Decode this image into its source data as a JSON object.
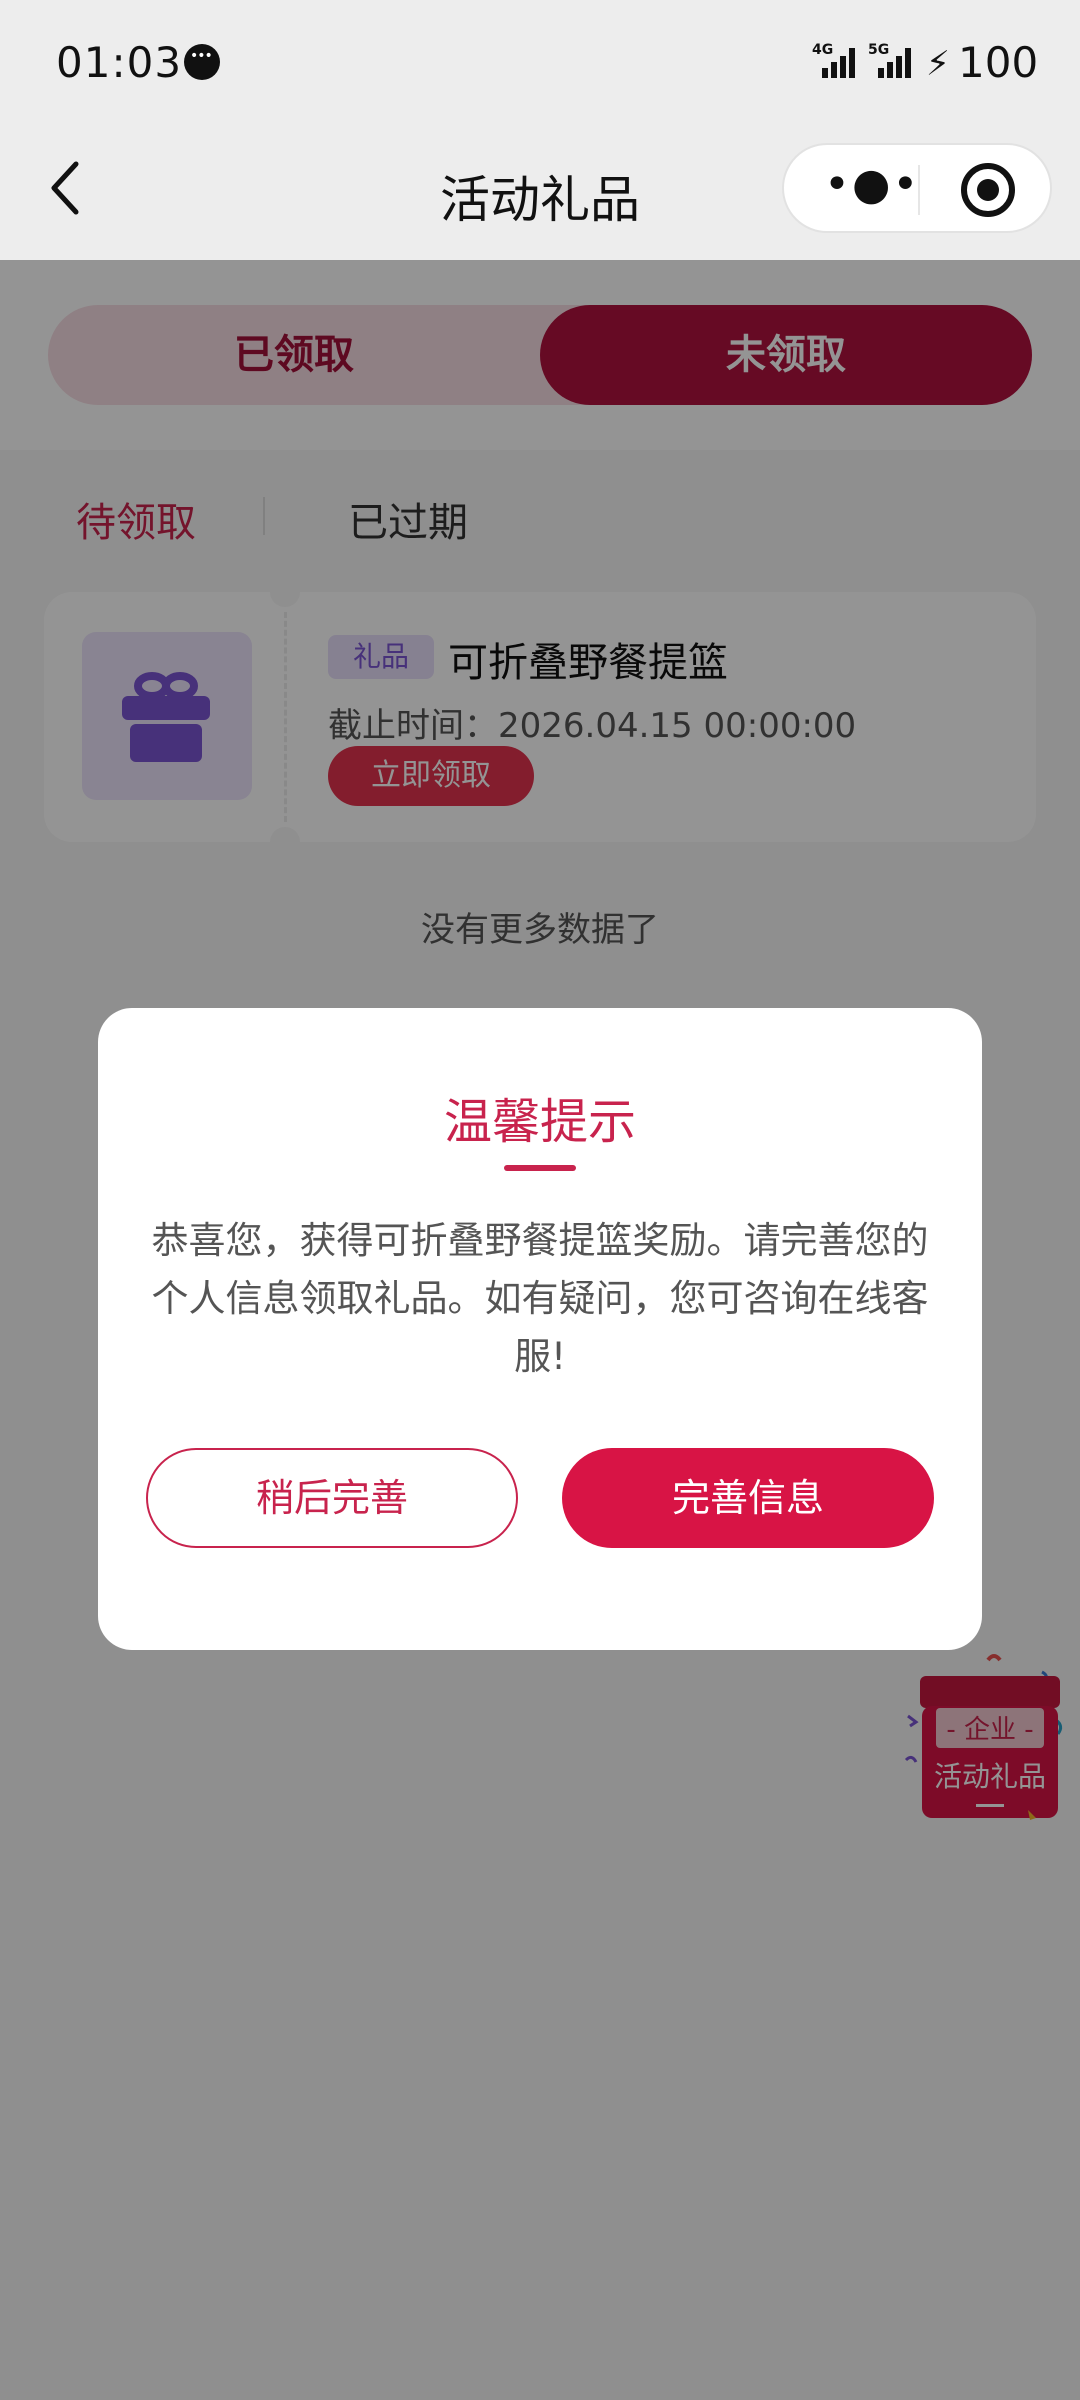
{
  "status_bar": {
    "time": "01:03",
    "network_1": "4G",
    "network_2": "5G",
    "battery": "100"
  },
  "header": {
    "title": "活动礼品"
  },
  "segment": {
    "claimed": "已领取",
    "unclaimed": "未领取",
    "active": "unclaimed"
  },
  "sub_tabs": {
    "pending": "待领取",
    "expired": "已过期",
    "active": "pending"
  },
  "gift_card": {
    "tag": "礼品",
    "name": "可折叠野餐提篮",
    "deadline": "截止时间：2026.04.15 00:00:00",
    "claim_button": "立即领取"
  },
  "list_footer": "没有更多数据了",
  "floating_badge": {
    "line1": "- 企业 -",
    "line2": "活动礼品"
  },
  "dialog": {
    "title": "温馨提示",
    "body": "恭喜您，获得可折叠野餐提篮奖励。请完善您的个人信息领取礼品。如有疑问，您可咨询在线客服!",
    "later_button": "稍后完善",
    "complete_button": "完善信息"
  },
  "colors": {
    "accent": "#c8234d",
    "segment_active": "#b0123f",
    "primary_button": "#d81445",
    "gift_purple": "#7a55d2"
  }
}
